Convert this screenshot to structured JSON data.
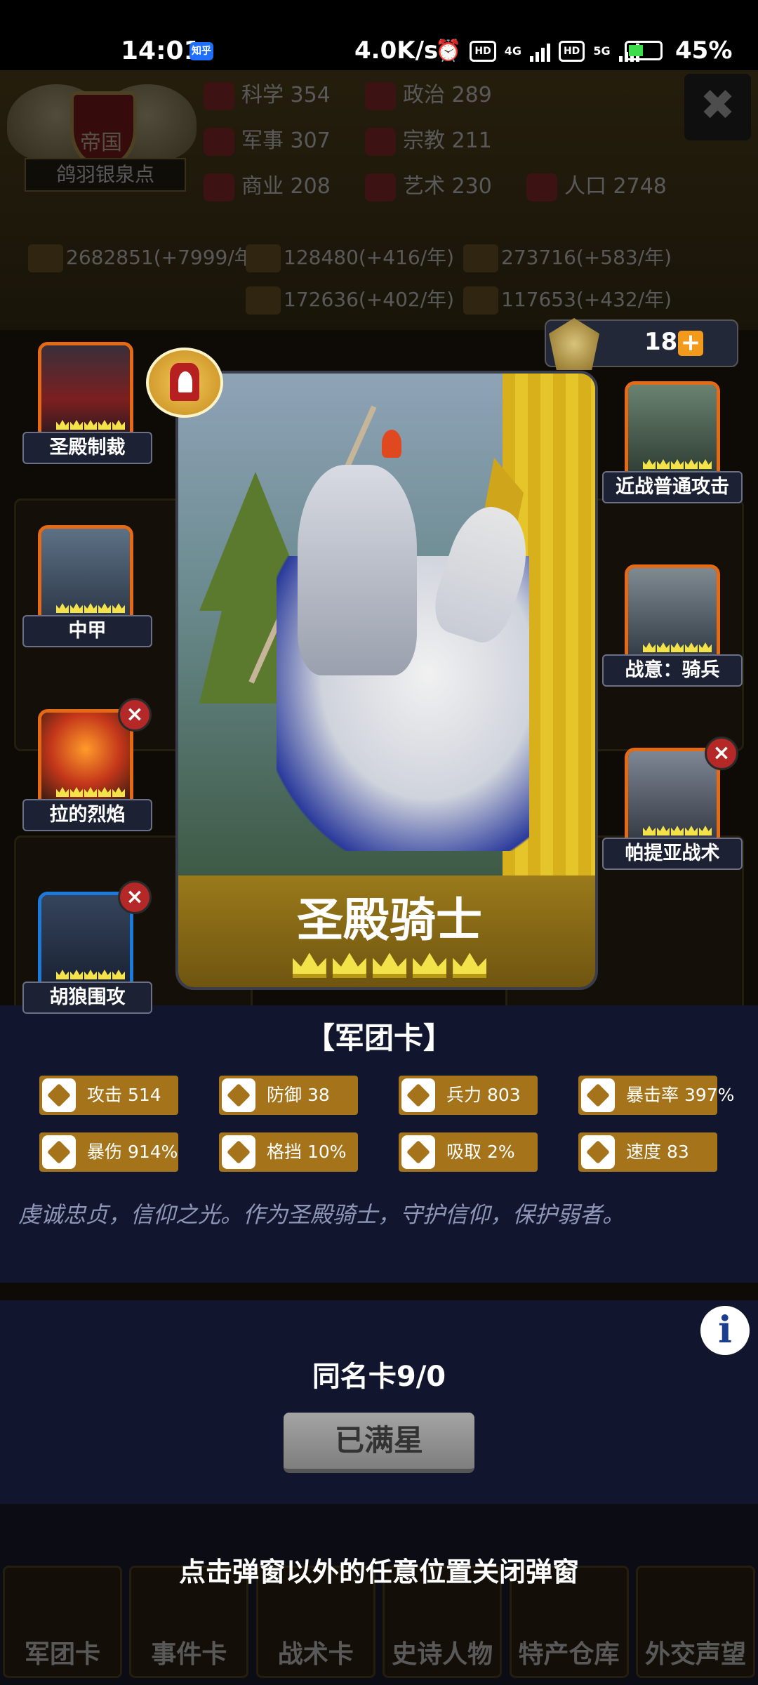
{
  "status_bar": {
    "time": "14:01",
    "app_badge": "知乎",
    "net_speed": "4.0K/s",
    "battery": "45%",
    "hd1": "HD",
    "hd2": "HD",
    "net1": "4G",
    "net2": "5G"
  },
  "background": {
    "emblem_title": "帝国",
    "place_name": "鸽羽银泉点",
    "stats": [
      {
        "label": "科学",
        "value": "354"
      },
      {
        "label": "政治",
        "value": "289"
      },
      {
        "label": "军事",
        "value": "307"
      },
      {
        "label": "宗教",
        "value": "211"
      },
      {
        "label": "商业",
        "value": "208"
      },
      {
        "label": "艺术",
        "value": "230"
      },
      {
        "label": "人口",
        "value": "2748"
      }
    ],
    "resources": [
      "2682851(+7999/年)",
      "128480(+416/年)",
      "273716(+583/年)",
      "172636(+402/年)",
      "117653(+432/年)"
    ],
    "close_glyph": "✖",
    "nav": [
      "军团卡",
      "事件卡",
      "战术卡",
      "史诗人物",
      "特产仓库",
      "外交声望"
    ]
  },
  "counter": {
    "value": "18",
    "plus": "+"
  },
  "card": {
    "name": "圣殿骑士",
    "stars": 5,
    "type_label": "【军团卡】",
    "attributes": [
      {
        "icon": "attack-icon",
        "label": "攻击",
        "value": "514"
      },
      {
        "icon": "defense-icon",
        "label": "防御",
        "value": "38"
      },
      {
        "icon": "troops-icon",
        "label": "兵力",
        "value": "803"
      },
      {
        "icon": "crit-rate-icon",
        "label": "暴击率",
        "value": "397%"
      },
      {
        "icon": "crit-damage-icon",
        "label": "暴伤",
        "value": "914%"
      },
      {
        "icon": "block-icon",
        "label": "格挡",
        "value": "10%"
      },
      {
        "icon": "lifesteal-icon",
        "label": "吸取",
        "value": "2%"
      },
      {
        "icon": "speed-icon",
        "label": "速度",
        "value": "83"
      }
    ],
    "description": "虔诚忠贞，信仰之光。作为圣殿骑士，守护信仰，保护弱者。",
    "duplicates": "同名卡9/0",
    "max_button": "已满星"
  },
  "skills_left": [
    {
      "label": "圣殿制裁",
      "removable": false,
      "frame": "orange"
    },
    {
      "label": "中甲",
      "removable": false,
      "frame": "orange"
    },
    {
      "label": "拉的烈焰",
      "removable": true,
      "frame": "orange"
    },
    {
      "label": "胡狼围攻",
      "removable": true,
      "frame": "blue"
    }
  ],
  "skills_right": [
    {
      "label": "近战普通攻击",
      "removable": false,
      "frame": "orange"
    },
    {
      "label": "战意：骑兵",
      "removable": false,
      "frame": "orange"
    },
    {
      "label": "帕提亚战术",
      "removable": true,
      "frame": "orange"
    }
  ],
  "hint_text": "点击弹窗以外的任意位置关闭弹窗",
  "colors": {
    "panel_bg": "#11162e",
    "attr_bg": "#a5741a",
    "frame_orange": "#e46a16",
    "frame_blue": "#1e7ad8",
    "crown_gold": "#f3e24a"
  }
}
